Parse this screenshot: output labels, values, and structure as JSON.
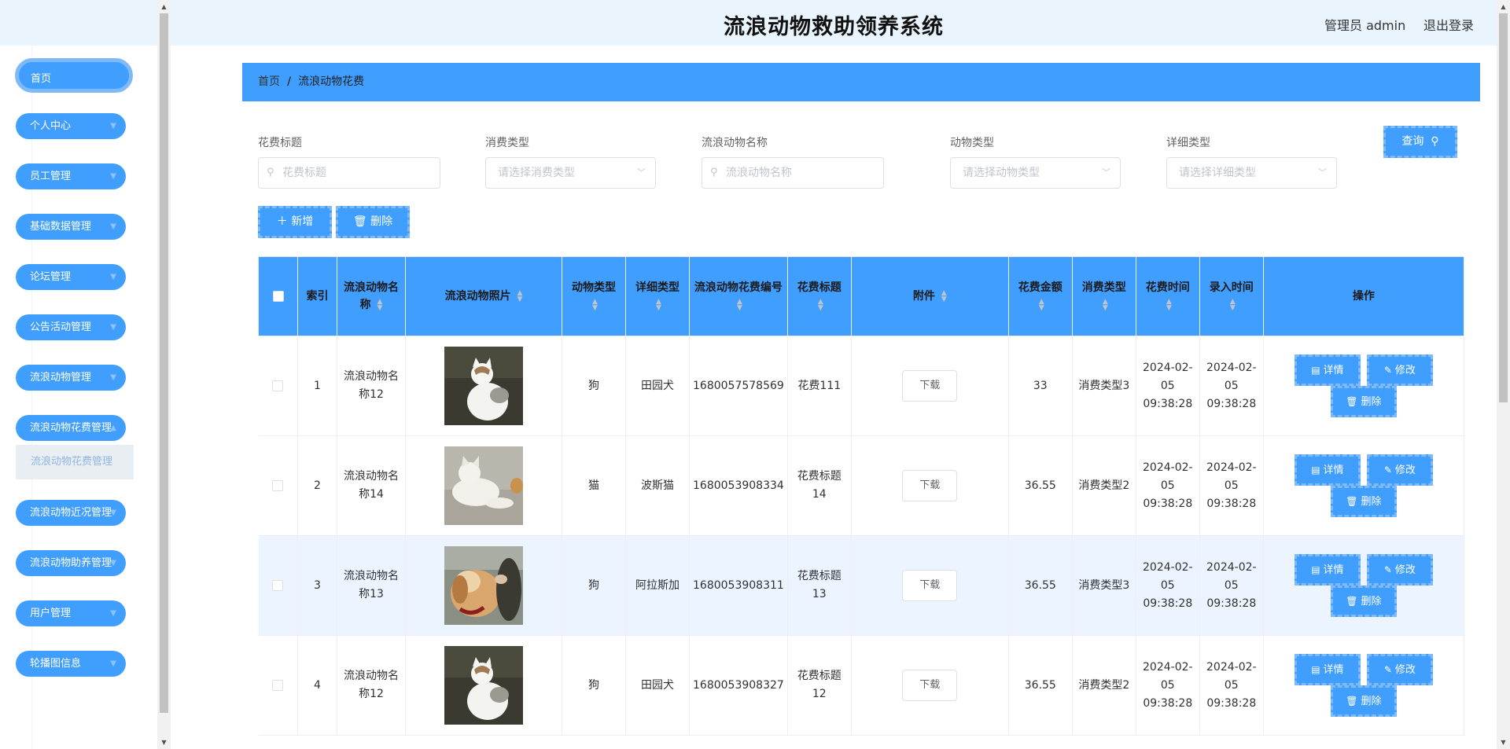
{
  "sidebar": {
    "items": [
      {
        "label": "首页"
      },
      {
        "label": "个人中心"
      },
      {
        "label": "员工管理"
      },
      {
        "label": "基础数据管理"
      },
      {
        "label": "论坛管理"
      },
      {
        "label": "公告活动管理"
      },
      {
        "label": "流浪动物管理"
      },
      {
        "label": "流浪动物花费管理"
      },
      {
        "label": "流浪动物近况管理"
      },
      {
        "label": "流浪动物助养管理"
      },
      {
        "label": "用户管理"
      },
      {
        "label": "轮播图信息"
      }
    ],
    "submenu": {
      "label": "流浪动物花费管理"
    }
  },
  "header": {
    "title": "流浪动物救助领养系统",
    "user": "管理员 admin",
    "logout": "退出登录"
  },
  "breadcrumb": {
    "home": "首页",
    "separator": "/",
    "current": "流浪动物花费"
  },
  "search": {
    "cost_title": {
      "label": "花费标题",
      "placeholder": "花费标题"
    },
    "consume_type": {
      "label": "消费类型",
      "placeholder": "请选择消费类型"
    },
    "animal_name": {
      "label": "流浪动物名称",
      "placeholder": "流浪动物名称"
    },
    "animal_type": {
      "label": "动物类型",
      "placeholder": "请选择动物类型"
    },
    "detail_type": {
      "label": "详细类型",
      "placeholder": "请选择详细类型"
    },
    "query_label": "查询"
  },
  "actions": {
    "add_label": "新增",
    "delete_label": "删除"
  },
  "table": {
    "columns": {
      "index": "索引",
      "name": "流浪动物名称",
      "photo": "流浪动物照片",
      "animal_type": "动物类型",
      "detail_type": "详细类型",
      "code": "流浪动物花费编号",
      "title": "花费标题",
      "attachment": "附件",
      "amount": "花费金额",
      "consume_type": "消费类型",
      "cost_time": "花费时间",
      "insert_time": "录入时间",
      "ops": "操作"
    },
    "download_label": "下载",
    "op_detail": "详情",
    "op_edit": "修改",
    "op_delete": "删除",
    "rows": [
      {
        "index": "1",
        "name": "流浪动物名称12",
        "animal_type": "狗",
        "detail_type": "田园犬",
        "code": "1680057578569",
        "title": "花费111",
        "amount": "33",
        "consume_type": "消费类型3",
        "cost_time": "2024-02-05 09:38:28",
        "insert_time": "2024-02-05 09:38:28"
      },
      {
        "index": "2",
        "name": "流浪动物名称14",
        "animal_type": "猫",
        "detail_type": "波斯猫",
        "code": "1680053908334",
        "title": "花费标题14",
        "amount": "36.55",
        "consume_type": "消费类型2",
        "cost_time": "2024-02-05 09:38:28",
        "insert_time": "2024-02-05 09:38:28"
      },
      {
        "index": "3",
        "name": "流浪动物名称13",
        "animal_type": "狗",
        "detail_type": "阿拉斯加",
        "code": "1680053908311",
        "title": "花费标题13",
        "amount": "36.55",
        "consume_type": "消费类型3",
        "cost_time": "2024-02-05 09:38:28",
        "insert_time": "2024-02-05 09:38:28"
      },
      {
        "index": "4",
        "name": "流浪动物名称12",
        "animal_type": "狗",
        "detail_type": "田园犬",
        "code": "1680053908327",
        "title": "花费标题12",
        "amount": "36.55",
        "consume_type": "消费类型2",
        "cost_time": "2024-02-05 09:38:28",
        "insert_time": "2024-02-05 09:38:28"
      }
    ]
  },
  "colors": {
    "primary": "#409eff",
    "header_bg": "#eaf4fd",
    "row_highlight": "#ecf5ff"
  }
}
